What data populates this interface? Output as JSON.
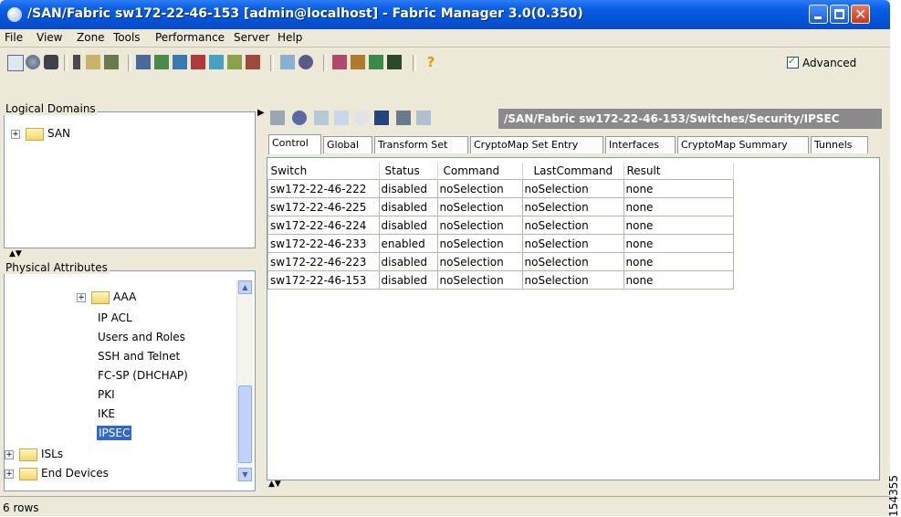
{
  "window": {
    "title": "/SAN/Fabric sw172-22-46-153 [admin@localhost] - Fabric Manager 3.0(0.350)"
  },
  "menu": [
    "File",
    "View",
    "Zone",
    "Tools",
    "Performance",
    "Server",
    "Help"
  ],
  "toolbar": {
    "advanced_label": "Advanced",
    "advanced_checked": true
  },
  "logical_domains": {
    "label": "Logical Domains",
    "items": [
      "SAN"
    ]
  },
  "physical_attributes": {
    "label": "Physical Attributes",
    "items": [
      "AAA",
      "IP ACL",
      "Users and Roles",
      "SSH and Telnet",
      "FC-SP (DHCHAP)",
      "PKI",
      "IKE",
      "IPSEC",
      "ISLs",
      "End Devices"
    ],
    "selected": "IPSEC"
  },
  "breadcrumb": "/SAN/Fabric sw172-22-46-153/Switches/Security/IPSEC",
  "tabs": [
    "Control",
    "Global",
    "Transform Set",
    "CryptoMap Set Entry",
    "Interfaces",
    "CryptoMap Summary",
    "Tunnels"
  ],
  "active_tab": "Control",
  "table": {
    "columns": [
      "Switch",
      "Status",
      "Command",
      "LastCommand",
      "Result"
    ],
    "rows": [
      [
        "sw172-22-46-222",
        "disabled",
        "noSelection",
        "noSelection",
        "none"
      ],
      [
        "sw172-22-46-225",
        "disabled",
        "noSelection",
        "noSelection",
        "none"
      ],
      [
        "sw172-22-46-224",
        "disabled",
        "noSelection",
        "noSelection",
        "none"
      ],
      [
        "sw172-22-46-233",
        "enabled",
        "noSelection",
        "noSelection",
        "none"
      ],
      [
        "sw172-22-46-223",
        "disabled",
        "noSelection",
        "noSelection",
        "none"
      ],
      [
        "sw172-22-46-153",
        "disabled",
        "noSelection",
        "noSelection",
        "none"
      ]
    ]
  },
  "status_bar": "6 rows",
  "figure_code": "154355",
  "colors": {
    "titlebar": "#0a5ee6",
    "selection": "#316ac5",
    "breadcrumb_bg": "#8a8a8a"
  }
}
